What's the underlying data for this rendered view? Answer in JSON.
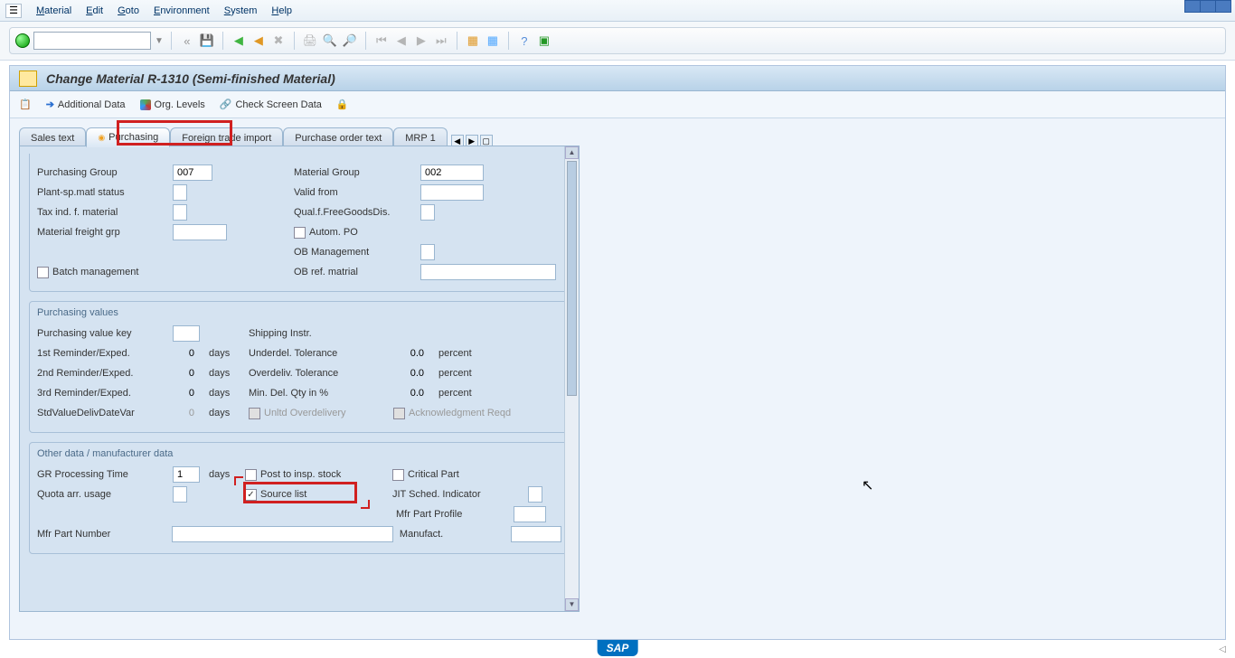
{
  "menu": {
    "items": [
      "Material",
      "Edit",
      "Goto",
      "Environment",
      "System",
      "Help"
    ]
  },
  "title": "Change Material R-1310 (Semi-finished Material)",
  "actions": {
    "additional_data": "Additional Data",
    "org_levels": "Org. Levels",
    "check_screen_data": "Check Screen Data"
  },
  "tabs": {
    "items": [
      "Sales text",
      "Purchasing",
      "Foreign trade import",
      "Purchase order text",
      "MRP 1"
    ],
    "active_index": 1
  },
  "general": {
    "purchasing_group_lbl": "Purchasing Group",
    "purchasing_group_val": "007",
    "material_group_lbl": "Material Group",
    "material_group_val": "002",
    "plant_sp_status_lbl": "Plant-sp.matl status",
    "valid_from_lbl": "Valid from",
    "tax_ind_lbl": "Tax ind. f. material",
    "qual_free_goods_lbl": "Qual.f.FreeGoodsDis.",
    "material_freight_lbl": "Material freight grp",
    "autom_po_lbl": "Autom. PO",
    "ob_management_lbl": "OB Management",
    "batch_mgmt_lbl": "Batch management",
    "ob_ref_matrial_lbl": "OB ref. matrial"
  },
  "purchasing_values": {
    "section_title": "Purchasing values",
    "value_key_lbl": "Purchasing value key",
    "shipping_instr_lbl": "Shipping Instr.",
    "rem1_lbl": "1st Reminder/Exped.",
    "rem2_lbl": "2nd Reminder/Exped.",
    "rem3_lbl": "3rd Reminder/Exped.",
    "std_val_lbl": "StdValueDelivDateVar",
    "days": "days",
    "percent": "percent",
    "underdel_lbl": "Underdel. Tolerance",
    "overdeliv_lbl": "Overdeliv. Tolerance",
    "min_del_lbl": "Min. Del. Qty in %",
    "unltd_lbl": "Unltd Overdelivery",
    "ack_lbl": "Acknowledgment Reqd",
    "rem1_val": "0",
    "rem2_val": "0",
    "rem3_val": "0",
    "std_val": "0",
    "underdel_val": "0.0",
    "overdeliv_val": "0.0",
    "min_del_val": "0.0"
  },
  "other_data": {
    "section_title": "Other data / manufacturer data",
    "gr_time_lbl": "GR Processing Time",
    "gr_time_val": "1",
    "days": "days",
    "post_insp_lbl": "Post to insp. stock",
    "critical_lbl": "Critical Part",
    "quota_lbl": "Quota arr. usage",
    "source_list_lbl": "Source list",
    "source_list_checked": true,
    "jit_lbl": "JIT Sched. Indicator",
    "mfr_profile_lbl": "Mfr Part Profile",
    "mfr_part_num_lbl": "Mfr Part Number",
    "manufact_lbl": "Manufact."
  },
  "sap_logo": "SAP"
}
